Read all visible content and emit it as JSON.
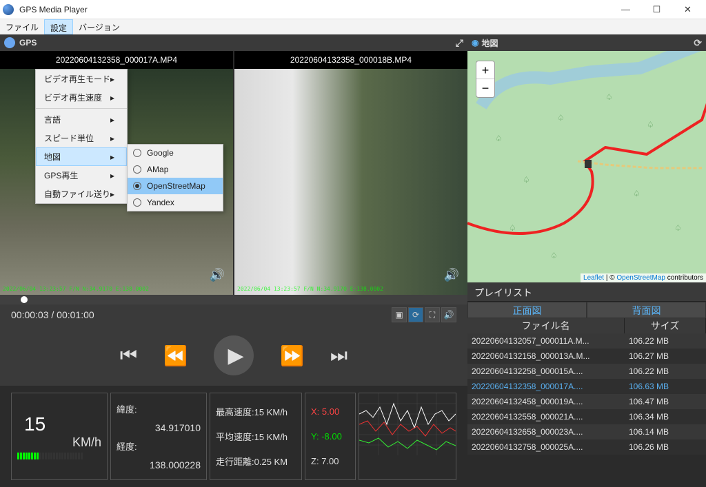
{
  "window": {
    "title": "GPS Media Player"
  },
  "menubar": {
    "file": "ファイル",
    "settings": "設定",
    "version": "バージョン"
  },
  "settings_menu": {
    "video_mode": "ビデオ再生モード",
    "video_speed": "ビデオ再生速度",
    "language": "言語",
    "speed_unit": "スピード単位",
    "map": "地図",
    "gps_play": "GPS再生",
    "auto_file_send": "自動ファイル送り"
  },
  "map_submenu": {
    "google": "Google",
    "amap": "AMap",
    "osm": "OpenStreetMap",
    "yandex": "Yandex",
    "selected": "osm"
  },
  "gps_header": "GPS",
  "videos": {
    "a": {
      "name": "20220604132358_000017A.MP4",
      "timestamp": "2022/06/04 13:23:57 F/N N:34.9170 E:138.0002"
    },
    "b": {
      "name": "20220604132358_000018B.MP4",
      "timestamp": "2022/06/04 13:23:57 F/N N:34.9170 E:138.0002"
    }
  },
  "time": {
    "current": "00:00:03",
    "total": "00:01:00"
  },
  "dashboard": {
    "speed": "15",
    "speed_unit": "KM/h",
    "lat_label": "緯度:",
    "lat": "34.917010",
    "lon_label": "経度:",
    "lon": "138.000228",
    "max_label": "最高速度:",
    "max": "15 KM/h",
    "avg_label": "平均速度:",
    "avg": "15 KM/h",
    "dist_label": "走行距離:",
    "dist": "0.25 KM",
    "x_label": "X:",
    "x": "5.00",
    "y_label": "Y:",
    "y": "-8.00",
    "z_label": "Z:",
    "z": "7.00"
  },
  "map": {
    "title": "地図",
    "leaflet": "Leaflet",
    "osm": "OpenStreetMap",
    "contributors": " contributors",
    "sep": " | © "
  },
  "playlist": {
    "title": "プレイリスト",
    "tab_front": "正面図",
    "tab_back": "背面図",
    "col_file": "ファイル名",
    "col_size": "サイズ",
    "files": [
      {
        "name": "20220604132057_000011A.M...",
        "size": "106.22 MB"
      },
      {
        "name": "20220604132158_000013A.M...",
        "size": "106.27 MB"
      },
      {
        "name": "20220604132258_000015A....",
        "size": "106.22 MB"
      },
      {
        "name": "20220604132358_000017A....",
        "size": "106.63 MB"
      },
      {
        "name": "20220604132458_000019A....",
        "size": "106.47 MB"
      },
      {
        "name": "20220604132558_000021A....",
        "size": "106.34 MB"
      },
      {
        "name": "20220604132658_000023A....",
        "size": "106.14 MB"
      },
      {
        "name": "20220604132758_000025A....",
        "size": "106.26 MB"
      }
    ],
    "selected_index": 3
  }
}
